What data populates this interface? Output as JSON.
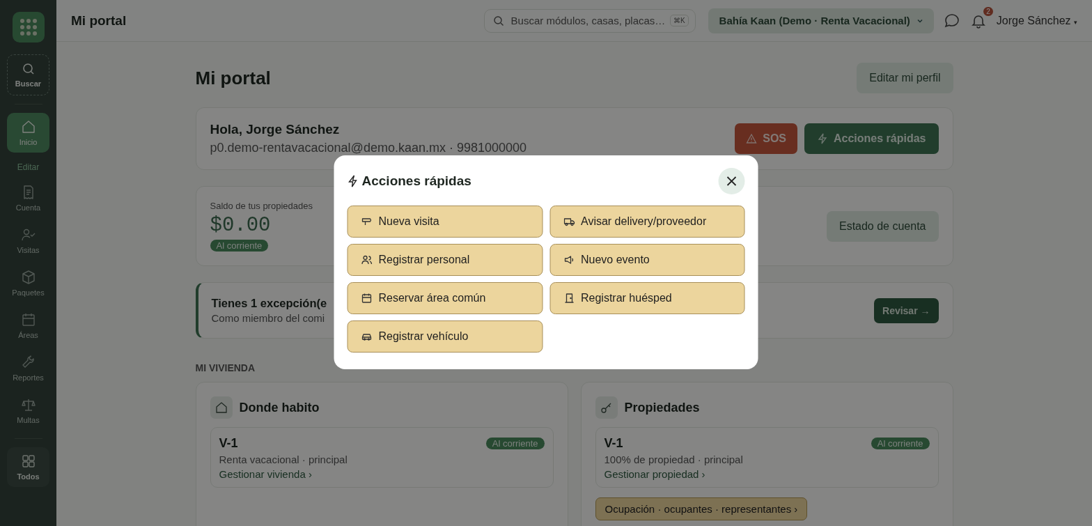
{
  "sidebar": {
    "search_label": "Buscar",
    "items": [
      {
        "label": "Inicio",
        "selected": true
      },
      {
        "label": "Cuenta",
        "selected": false
      },
      {
        "label": "Visitas",
        "selected": false
      },
      {
        "label": "Paquetes",
        "selected": false
      },
      {
        "label": "Áreas",
        "selected": false
      },
      {
        "label": "Reportes",
        "selected": false
      },
      {
        "label": "Multas",
        "selected": false
      }
    ],
    "edit_link": "Editar",
    "all_label": "Todos"
  },
  "topbar": {
    "title": "Mi portal",
    "search": {
      "placeholder": "Buscar módulos, casas, placas…",
      "shortcut": "⌘K"
    },
    "community": "Bahía Kaan (Demo · Renta Vacacional)",
    "notifications": "2",
    "user": "Jorge Sánchez",
    "user_caret": "▾"
  },
  "page": {
    "heading": "Mi portal",
    "edit_profile": "Editar mi perfil",
    "greeting": {
      "title": "Hola, Jorge Sánchez",
      "contact": "p0.demo-rentavacacional@demo.kaan.mx · 9981000000",
      "sos": "SOS",
      "quick_actions": "Acciones rápidas"
    },
    "balance": {
      "label": "Saldo de tus propiedades",
      "amount": "$0.00",
      "status": "Al corriente",
      "button": "Estado de cuenta"
    },
    "alert": {
      "title": "Tienes 1 excepción(e",
      "text": "Como miembro del comi",
      "button": "Revisar →"
    },
    "section": "MI VIVIENDA",
    "cards": [
      {
        "title": "Donde habito",
        "unit": "V-1",
        "status": "Al corriente",
        "detail": "Renta vacacional · principal",
        "link": "Gestionar vivienda ›"
      },
      {
        "title": "Propiedades",
        "unit": "V-1",
        "status": "Al corriente",
        "detail": "100% de propiedad · principal",
        "link": "Gestionar propiedad ›",
        "extra": "Ocupación · ocupantes · representantes ›"
      }
    ]
  },
  "modal": {
    "title": "Acciones rápidas",
    "actions": [
      {
        "label": "Nueva visita",
        "kind": "visit"
      },
      {
        "label": "Avisar delivery/proveedor",
        "kind": "delivery"
      },
      {
        "label": "Registrar personal",
        "kind": "staff"
      },
      {
        "label": "Nuevo evento",
        "kind": "event"
      },
      {
        "label": "Reservar área común",
        "kind": "calendar"
      },
      {
        "label": "Registrar huésped",
        "kind": "guest"
      },
      {
        "label": "Registrar vehículo",
        "kind": "vehicle"
      }
    ]
  }
}
